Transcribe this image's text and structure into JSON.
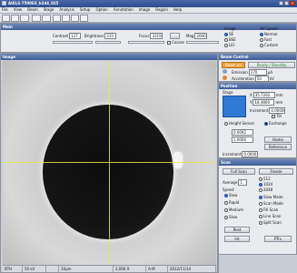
{
  "app": {
    "title": "AtELS-7500EX_b2d4_025"
  },
  "menu": [
    "File",
    "View",
    "Beam",
    "Stage",
    "Analysis",
    "Setup",
    "Option",
    "Annotation",
    "Image",
    "Region",
    "Help"
  ],
  "main_panel": {
    "title": "Main",
    "contrast_label": "Contrast",
    "contrast_value": "127",
    "brightness_label": "Brightness",
    "brightness_value": "215",
    "focus_label": "Focus",
    "focus_value": "33191",
    "mag_label": "Mag",
    "mag_value": "2000",
    "coarse_label": "Coarse",
    "image_group_label": "Image",
    "image_options": [
      "SE",
      "BSE",
      "LEI"
    ],
    "hv_label": "HV Speed",
    "hv_options": [
      "Normal",
      "Fast",
      "Custom"
    ]
  },
  "image_panel": {
    "title": "Image",
    "status_bar": [
      "BTH",
      "50 kV",
      "",
      "10µm",
      "2,000 X",
      "A-M",
      "2012/11/14"
    ]
  },
  "beam": {
    "title": "Beam Control",
    "on_label": "Beam on",
    "ready_label": "Ready / Standby",
    "emission_label": "Emission",
    "emission_value": "170",
    "emission_unit": "µA",
    "acceleration_label": "Acceleration",
    "acceleration_value": "50",
    "acceleration_unit": "kV"
  },
  "position": {
    "title": "Position",
    "stage_label": "Stage",
    "x_label": "X",
    "x_value": "35.7262",
    "x_unit": "mm",
    "y_label": "Y",
    "y_value": "18.4800",
    "y_unit": "mm",
    "increment_label": "Increment",
    "increment_value": "0.00000",
    "tilt_label": "Tilt",
    "height_sensor_label": "Height Sensor",
    "exchange_label": "Exchange",
    "z_value": "0.0092",
    "r_value": "1.0000",
    "home_label": "Home",
    "reference_label": "Reference",
    "increment2_label": "Increment",
    "increment2_value": "0.0000"
  },
  "scan": {
    "title": "Scan",
    "full_scan_label": "Full Scan",
    "freeze_label": "Freeze",
    "average_label": "Average",
    "average_value": "1",
    "sizes": [
      "512",
      "1024",
      "2048"
    ],
    "speed_label": "Speed",
    "speed_options": [
      "Slow",
      "Rapid",
      "Medium",
      "Slow"
    ],
    "mode_options": [
      "Slow Mode",
      "Scan Mode",
      "Fill Scan",
      "Line Scan",
      "Split Scan"
    ],
    "btn_rest": "Rest",
    "btn_int": "Int",
    "btn_ptrs": "PTrs"
  },
  "colors": {
    "accent": "#2e7bd6",
    "titlebar": "#3f5e99",
    "crosshair": "#e6e64d"
  }
}
